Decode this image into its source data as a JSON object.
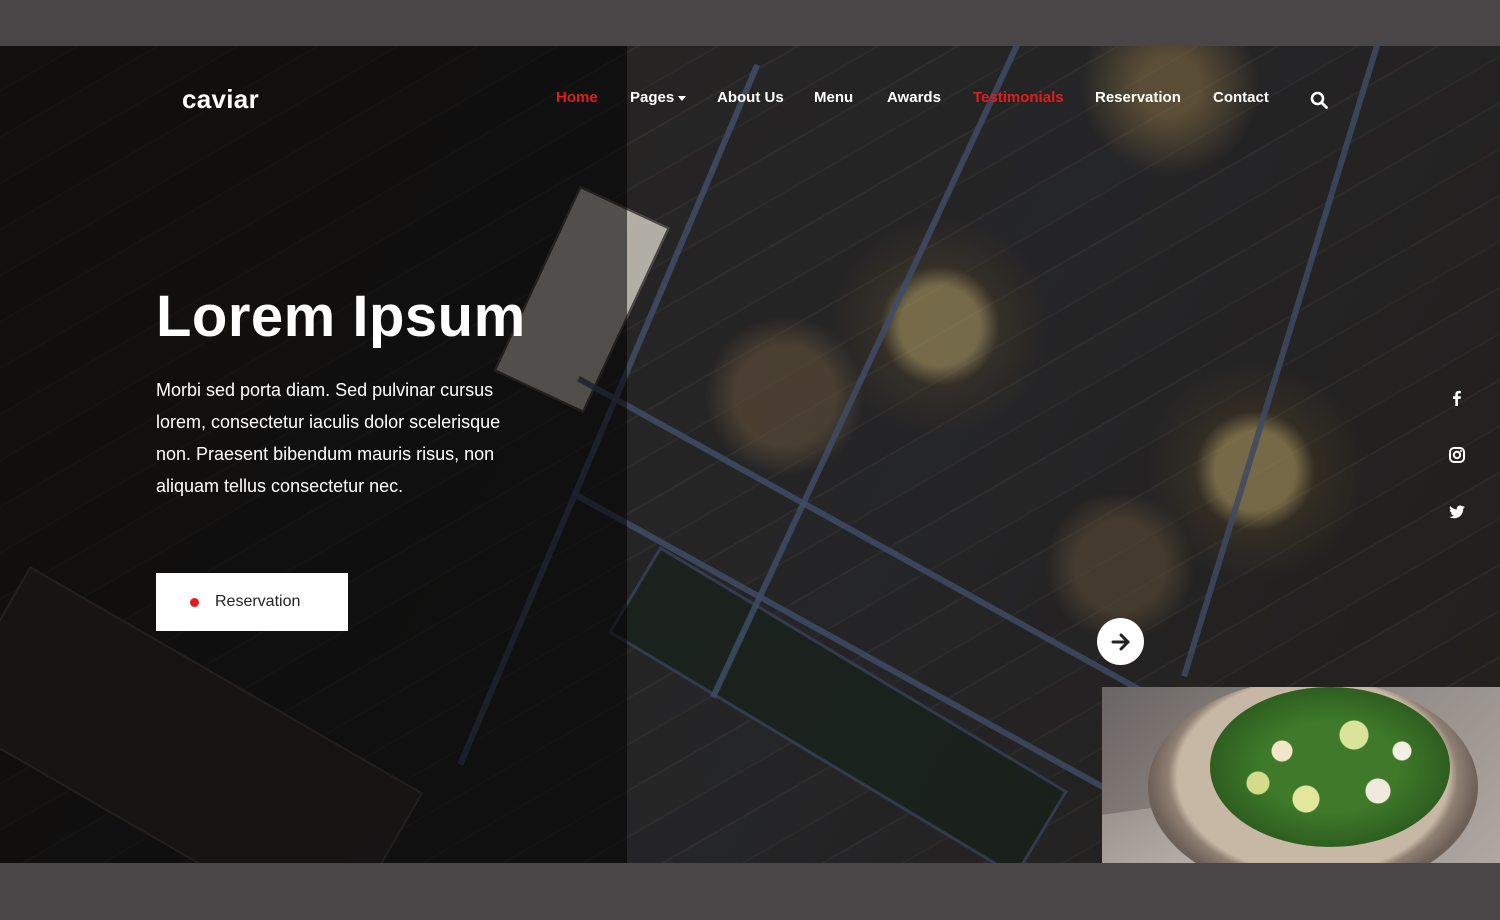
{
  "brand": {
    "logo": "caviar"
  },
  "nav": {
    "items": [
      {
        "label": "Home",
        "active": true
      },
      {
        "label": "Pages",
        "dropdown": true
      },
      {
        "label": "About Us"
      },
      {
        "label": "Menu"
      },
      {
        "label": "Awards"
      },
      {
        "label": "Testimonials",
        "active": true
      },
      {
        "label": "Reservation"
      },
      {
        "label": "Contact"
      }
    ],
    "search_icon": "search-icon"
  },
  "hero": {
    "title": "Lorem Ipsum",
    "text": "Morbi sed porta diam. Sed pulvinar cursus lorem, consectetur iaculis dolor scelerisque non. Praesent bibendum mauris risus, non aliquam tellus consectetur nec.",
    "button_label": "Reservation"
  },
  "socials": [
    "facebook-icon",
    "instagram-icon",
    "twitter-icon"
  ],
  "slider": {
    "next_icon": "arrow-right-icon"
  },
  "colors": {
    "accent": "#e41b1b",
    "white": "#ffffff",
    "frame": "#4a4647"
  }
}
